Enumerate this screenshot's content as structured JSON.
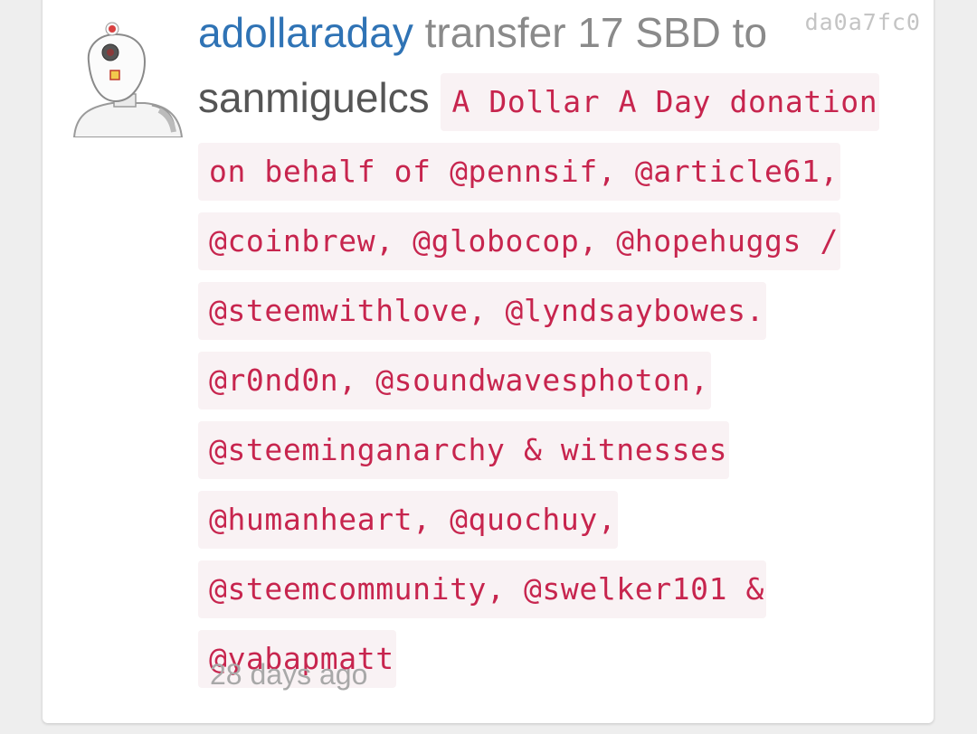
{
  "transfer": {
    "author": "adollaraday",
    "action_part1": "transfer 17",
    "action_part2": "SBD to",
    "recipient": "sanmiguelcs",
    "memo_lines": [
      "A Dollar A Day",
      "donation on behalf of @pennsif,",
      "@article61, @coinbrew, @globocop,",
      "@hopehuggs / @steemwithlove,",
      "@lyndsaybowes. @r0nd0n,",
      "@soundwavesphoton, @steeminganarchy &",
      "witnesses @humanheart, @quochuy,",
      "@steemcommunity, @swelker101 &",
      "@yabapmatt"
    ],
    "tx_id": "da0a7fc0",
    "time_ago": "28 days ago"
  },
  "colors": {
    "author": "#2f73b5",
    "memo_text": "#c7254e",
    "memo_background": "#f9f2f4",
    "muted_text": "#8a8a8a"
  },
  "icons": {
    "avatar": "robot-avatar"
  }
}
